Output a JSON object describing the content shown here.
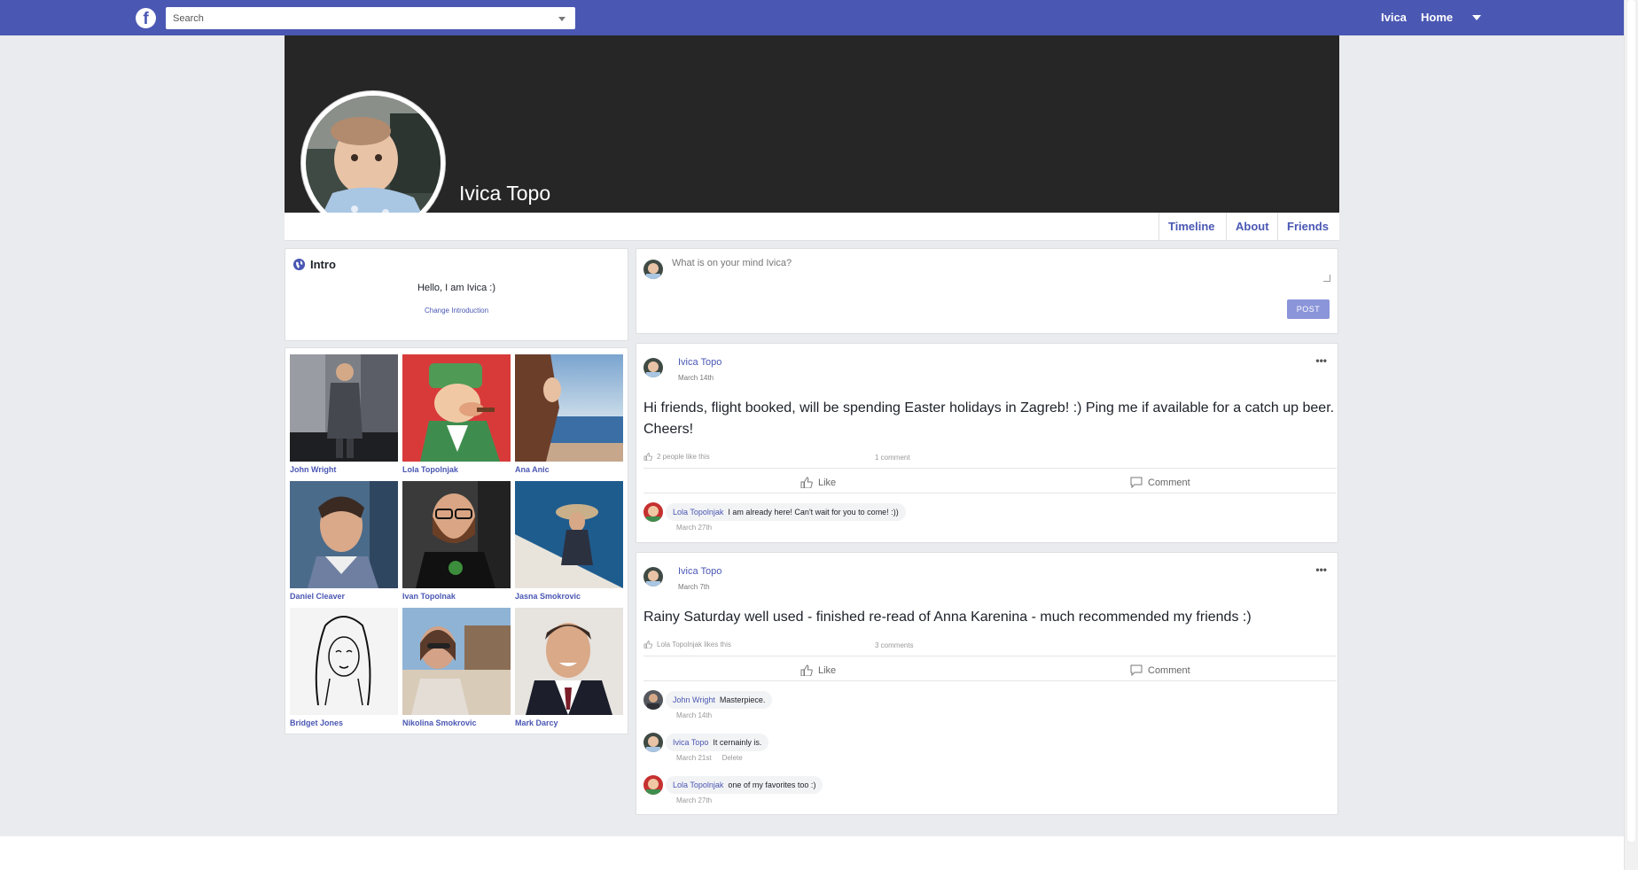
{
  "topbar": {
    "logo": "f",
    "search_placeholder": "Search",
    "user_link": "Ivica",
    "home_link": "Home",
    "brand_color": "#4a57b3"
  },
  "profile": {
    "name": "Ivica Topo",
    "tabs": [
      "Timeline",
      "About",
      "Friends"
    ]
  },
  "intro": {
    "title": "Intro",
    "text": "Hello, I am Ivica :)",
    "change_link": "Change Introduction"
  },
  "friends": [
    {
      "name": "John Wright"
    },
    {
      "name": "Lola Topolnjak"
    },
    {
      "name": "Ana Anic"
    },
    {
      "name": "Daniel Cleaver"
    },
    {
      "name": "Ivan Topolnak"
    },
    {
      "name": "Jasna Smokrovic"
    },
    {
      "name": "Bridget Jones"
    },
    {
      "name": "Nikolina Smokrovic"
    },
    {
      "name": "Mark Darcy"
    }
  ],
  "composer": {
    "placeholder": "What is on your mind Ivica?",
    "post_label": "POST"
  },
  "posts": [
    {
      "author": "Ivica Topo",
      "date": "March 14th",
      "text": "Hi friends, flight booked, will be spending Easter holidays in Zagreb! :) Ping me if available for a catch up beer. Cheers!",
      "likes": "2 people like this",
      "comment_count": "1 comment",
      "like_label": "Like",
      "comment_label": "Comment",
      "comments": [
        {
          "author": "Lola Topolnjak",
          "text": "I am already here! Can't wait for you to come! :))",
          "date": "March 27th"
        }
      ]
    },
    {
      "author": "Ivica Topo",
      "date": "March 7th",
      "text": "Rainy Saturday well used - finished re-read of Anna Karenina - much recommended my friends :)",
      "likes": "Lola Topolnjak likes this",
      "comment_count": "3 comments",
      "like_label": "Like",
      "comment_label": "Comment",
      "comments": [
        {
          "author": "John Wright",
          "text": "Masterpiece.",
          "date": "March 14th"
        },
        {
          "author": "Ivica Topo",
          "text": "It cernainly is.",
          "date": "March 21st",
          "action": "Delete"
        },
        {
          "author": "Lola Topolnjak",
          "text": "one of my favorites too :)",
          "date": "March 27th"
        }
      ]
    }
  ]
}
